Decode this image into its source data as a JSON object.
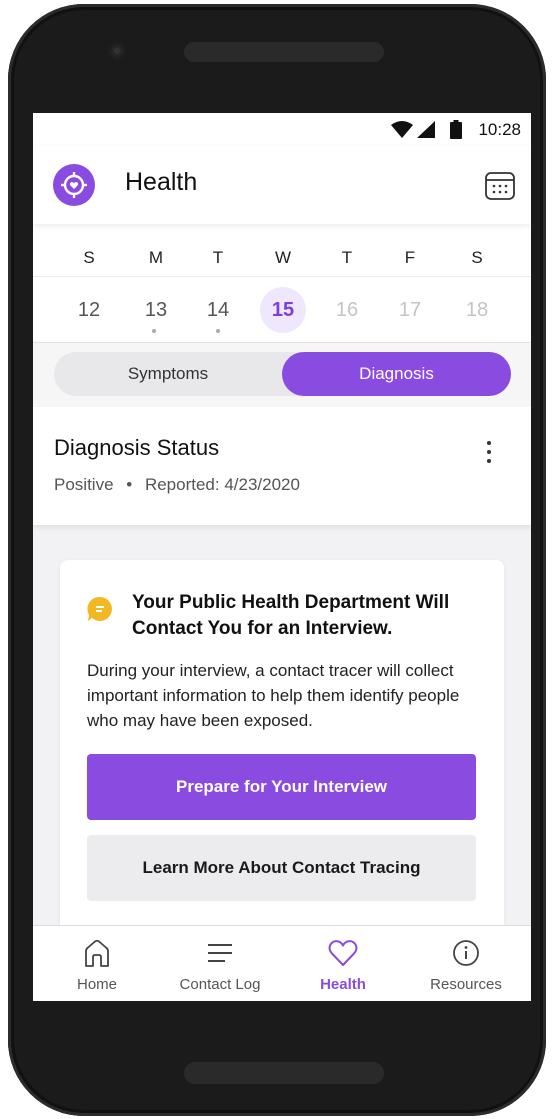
{
  "status_bar": {
    "time": "10:28"
  },
  "app_bar": {
    "title": "Health",
    "logo_icon": "heart-target-icon",
    "calendar_icon": "calendar-icon"
  },
  "week": {
    "days_of_week": [
      "S",
      "M",
      "T",
      "W",
      "T",
      "F",
      "S"
    ],
    "dates": [
      "12",
      "13",
      "14",
      "15",
      "16",
      "17",
      "18"
    ],
    "selected_date": "15",
    "dates_with_entries": [
      "13",
      "14"
    ]
  },
  "segmented": {
    "left_label": "Symptoms",
    "right_label": "Diagnosis",
    "active": "Diagnosis"
  },
  "diagnosis": {
    "title": "Diagnosis Status",
    "status": "Positive",
    "separator": "•",
    "reported": "Reported: 4/23/2020"
  },
  "info_card": {
    "heading": "Your Public Health Department Will Contact You for an Interview.",
    "body": "During your interview, a contact tracer will collect important information to help them identify people who may have been exposed.",
    "primary_button": "Prepare for Your Interview",
    "secondary_button": "Learn More About Contact Tracing"
  },
  "tab_bar": {
    "items": [
      {
        "label": "Home",
        "icon": "home-icon"
      },
      {
        "label": "Contact Log",
        "icon": "menu-lines-icon"
      },
      {
        "label": "Health",
        "icon": "heart-icon"
      },
      {
        "label": "Resources",
        "icon": "info-icon"
      }
    ],
    "active": "Health"
  },
  "colors": {
    "accent": "#8a4be0",
    "accent_light": "#efe8fd",
    "chat_icon": "#f2b824"
  }
}
